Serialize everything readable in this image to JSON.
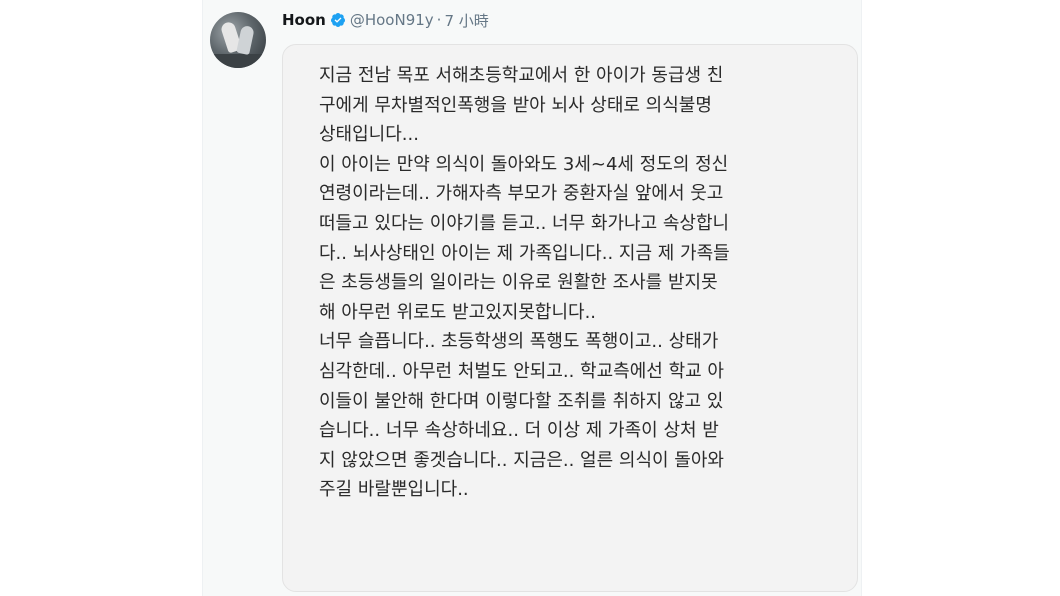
{
  "tweet": {
    "author_name": "Hoon",
    "handle": "@HooN91y",
    "separator": "·",
    "time": "7 小時",
    "verified_icon": "verified-badge-icon",
    "verified_color": "#1da1f2",
    "avatar_icon": "avatar-photo",
    "text_lines": [
      "지금 전남 목포 서해초등학교에서 한 아이가 동급생 친",
      "구에게 무차별적인폭행을 받아 뇌사 상태로 의식불명",
      "상태입니다...",
      "이 아이는 만약 의식이 돌아와도 3세~4세 정도의 정신",
      "연령이라는데.. 가해자측 부모가 중환자실 앞에서 웃고",
      "떠들고 있다는 이야기를 듣고.. 너무 화가나고 속상합니",
      "다.. 뇌사상태인 아이는 제 가족입니다.. 지금 제 가족들",
      "은 초등생들의 일이라는 이유로 원활한 조사를 받지못",
      "해 아무런 위로도 받고있지못합니다..",
      "너무 슬픕니다.. 초등학생의 폭행도 폭행이고.. 상태가",
      "심각한데.. 아무런 처벌도 안되고.. 학교측에선 학교 아",
      "이들이 불안해 한다며 이렇다할 조취를 취하지 않고 있",
      "습니다.. 너무 속상하네요.. 더 이상 제 가족이 상처 받",
      "지 않았으면 좋겟습니다.. 지금은.. 얼른 의식이 돌아와",
      "주길 바랄뿐입니다.."
    ]
  }
}
